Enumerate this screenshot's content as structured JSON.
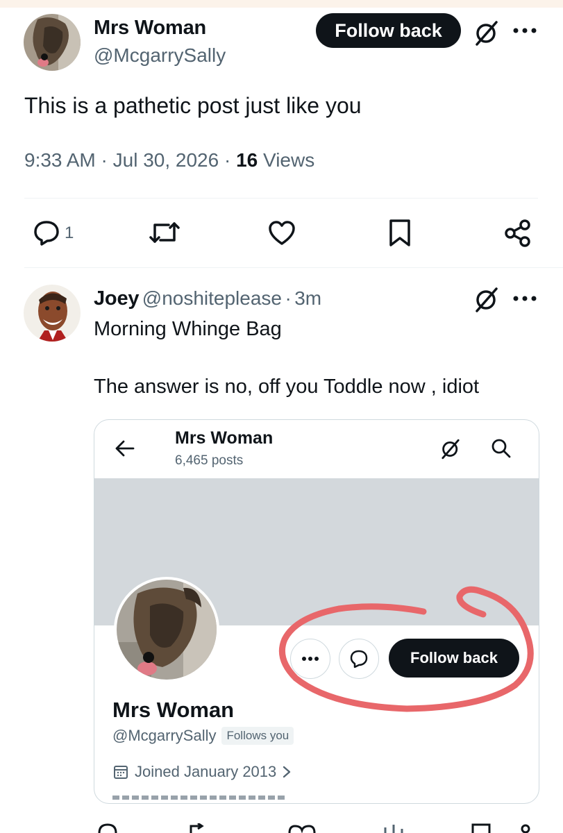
{
  "tweet": {
    "author_name": "Mrs Woman",
    "author_handle": "@McgarrySally",
    "follow_label": "Follow back",
    "text": "This is a pathetic post just like you",
    "time": "9:33 AM",
    "date": "Jul 30, 2026",
    "views_count": "16",
    "views_label": "Views",
    "reply_count": "1"
  },
  "reply": {
    "author_name": "Joey",
    "author_handle": "@noshiteplease",
    "age": "3m",
    "line1": "Morning Whinge Bag",
    "line2": "The answer is no, off you Toddle now , idiot"
  },
  "embed": {
    "title": "Mrs Woman",
    "posts": "6,465 posts",
    "profile_name": "Mrs Woman",
    "profile_handle": "@McgarrySally",
    "follows_you": "Follows you",
    "joined": "Joined January 2013",
    "follow_label": "Follow back"
  },
  "colors": {
    "accent_dark": "#0f1419",
    "secondary_text": "#536471",
    "highlight_circle": "#e8676a",
    "banner": "#d3d8dc"
  },
  "icons": [
    "grok-icon",
    "more-icon",
    "reply-icon",
    "retweet-icon",
    "like-icon",
    "bookmark-icon",
    "share-icon",
    "back-arrow-icon",
    "search-icon",
    "message-icon",
    "calendar-icon",
    "chevron-right-icon"
  ]
}
